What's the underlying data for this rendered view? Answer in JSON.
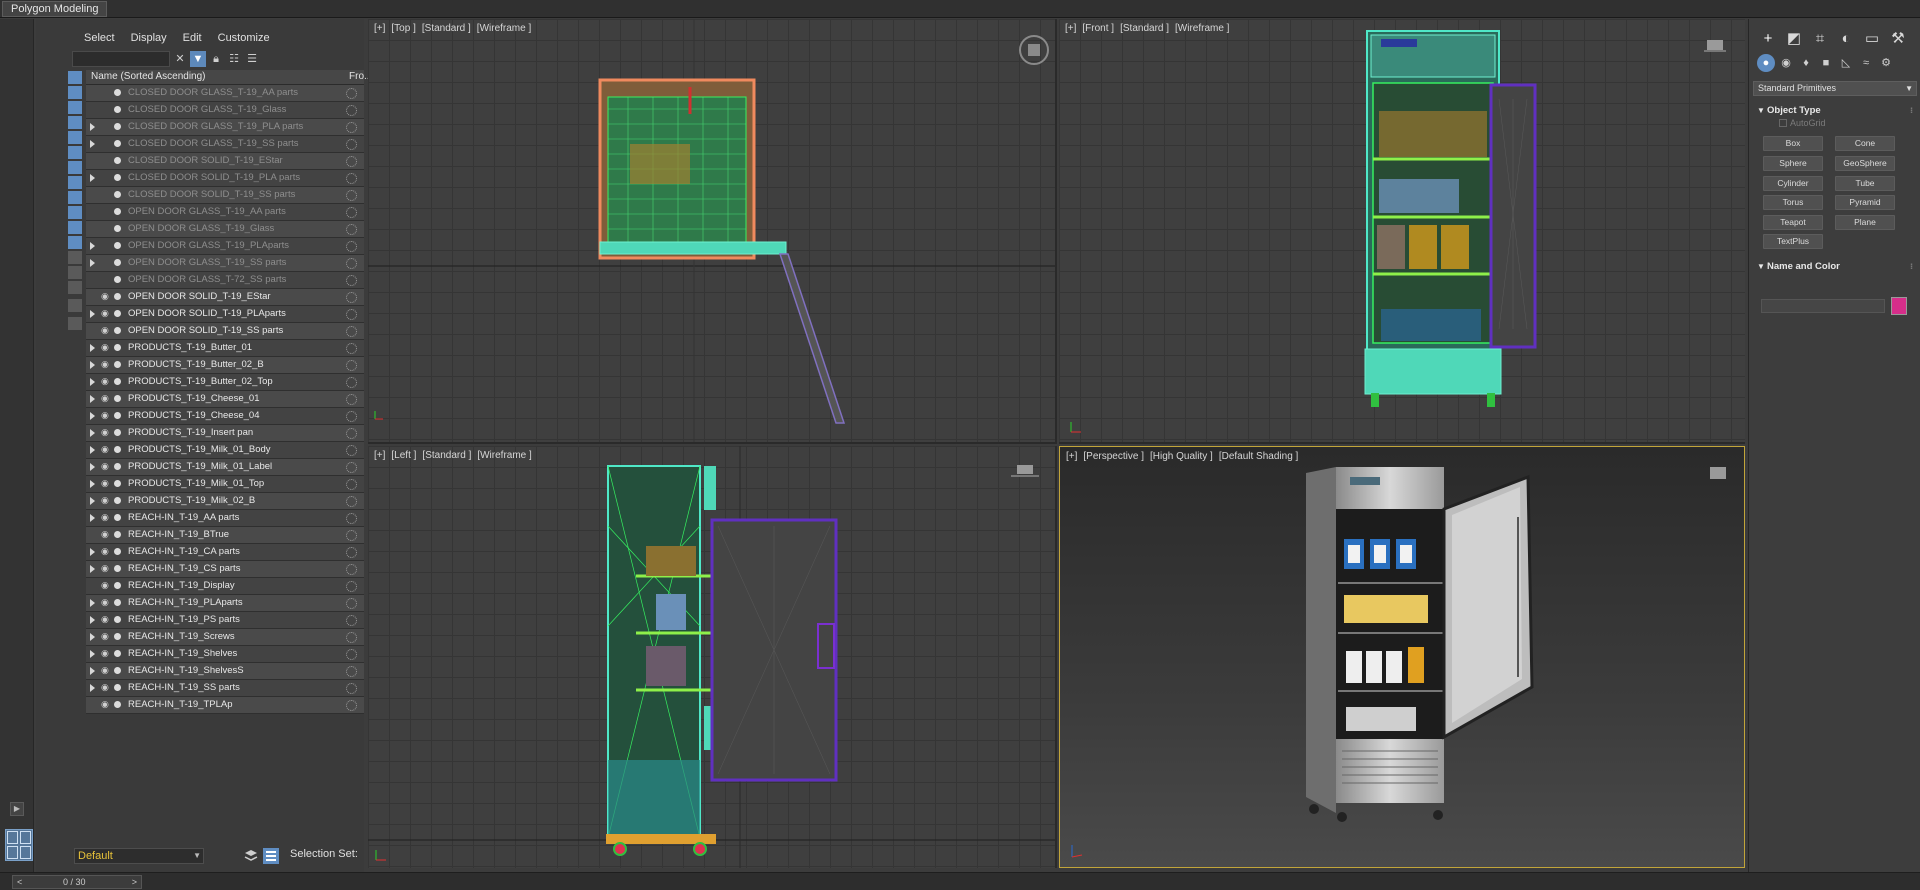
{
  "ribbon": {
    "tab_label": "Polygon Modeling"
  },
  "explorer": {
    "menu": [
      "Select",
      "Display",
      "Edit",
      "Customize"
    ],
    "columns": {
      "name": "Name (Sorted Ascending)",
      "frozen": "Fro..."
    },
    "rows": [
      {
        "label": "CLOSED DOOR GLASS_T-19_AA parts",
        "state": "hidden",
        "expandable": false
      },
      {
        "label": "CLOSED DOOR GLASS_T-19_Glass",
        "state": "hidden",
        "expandable": false
      },
      {
        "label": "CLOSED DOOR GLASS_T-19_PLA parts",
        "state": "hidden",
        "expandable": true
      },
      {
        "label": "CLOSED DOOR GLASS_T-19_SS parts",
        "state": "hidden",
        "expandable": true
      },
      {
        "label": "CLOSED DOOR SOLID_T-19_EStar",
        "state": "hidden",
        "expandable": false
      },
      {
        "label": "CLOSED DOOR SOLID_T-19_PLA parts",
        "state": "hidden",
        "expandable": true
      },
      {
        "label": "CLOSED DOOR SOLID_T-19_SS parts",
        "state": "hidden",
        "expandable": false
      },
      {
        "label": "OPEN DOOR GLASS_T-19_AA parts",
        "state": "hidden",
        "expandable": false
      },
      {
        "label": "OPEN DOOR GLASS_T-19_Glass",
        "state": "hidden",
        "expandable": false
      },
      {
        "label": "OPEN DOOR GLASS_T-19_PLAparts",
        "state": "hidden",
        "expandable": true
      },
      {
        "label": "OPEN DOOR GLASS_T-19_SS parts",
        "state": "hidden",
        "expandable": true
      },
      {
        "label": "OPEN DOOR GLASS_T-72_SS parts",
        "state": "hidden",
        "expandable": false
      },
      {
        "label": "OPEN DOOR SOLID_T-19_EStar",
        "state": "shown",
        "expandable": false
      },
      {
        "label": "OPEN DOOR SOLID_T-19_PLAparts",
        "state": "shown",
        "expandable": true
      },
      {
        "label": "OPEN DOOR SOLID_T-19_SS parts",
        "state": "shown",
        "expandable": false
      },
      {
        "label": "PRODUCTS_T-19_Butter_01",
        "state": "shown",
        "expandable": true
      },
      {
        "label": "PRODUCTS_T-19_Butter_02_B",
        "state": "shown",
        "expandable": true
      },
      {
        "label": "PRODUCTS_T-19_Butter_02_Top",
        "state": "shown",
        "expandable": true
      },
      {
        "label": "PRODUCTS_T-19_Cheese_01",
        "state": "shown",
        "expandable": true
      },
      {
        "label": "PRODUCTS_T-19_Cheese_04",
        "state": "shown",
        "expandable": true
      },
      {
        "label": "PRODUCTS_T-19_Insert pan",
        "state": "shown",
        "expandable": true
      },
      {
        "label": "PRODUCTS_T-19_Milk_01_Body",
        "state": "shown",
        "expandable": true
      },
      {
        "label": "PRODUCTS_T-19_Milk_01_Label",
        "state": "shown",
        "expandable": true
      },
      {
        "label": "PRODUCTS_T-19_Milk_01_Top",
        "state": "shown",
        "expandable": true
      },
      {
        "label": "PRODUCTS_T-19_Milk_02_B",
        "state": "shown",
        "expandable": true
      },
      {
        "label": "REACH-IN_T-19_AA parts",
        "state": "shown",
        "expandable": true
      },
      {
        "label": "REACH-IN_T-19_BTrue",
        "state": "shown",
        "expandable": false
      },
      {
        "label": "REACH-IN_T-19_CA parts",
        "state": "shown",
        "expandable": true
      },
      {
        "label": "REACH-IN_T-19_CS parts",
        "state": "shown",
        "expandable": true
      },
      {
        "label": "REACH-IN_T-19_Display",
        "state": "shown",
        "expandable": false
      },
      {
        "label": "REACH-IN_T-19_PLAparts",
        "state": "shown",
        "expandable": true
      },
      {
        "label": "REACH-IN_T-19_PS parts",
        "state": "shown",
        "expandable": true
      },
      {
        "label": "REACH-IN_T-19_Screws",
        "state": "shown",
        "expandable": true
      },
      {
        "label": "REACH-IN_T-19_Shelves",
        "state": "shown",
        "expandable": true
      },
      {
        "label": "REACH-IN_T-19_ShelvesS",
        "state": "shown",
        "expandable": true
      },
      {
        "label": "REACH-IN_T-19_SS parts",
        "state": "shown",
        "expandable": true
      },
      {
        "label": "REACH-IN_T-19_TPLAp",
        "state": "shown",
        "expandable": false
      }
    ],
    "layer_value": "Default",
    "selection_set_label": "Selection Set:"
  },
  "status": {
    "frame": "0 / 30",
    "prev": "<",
    "next": ">"
  },
  "viewports": {
    "top": [
      "[+]",
      "[Top ]",
      "[Standard ]",
      "[Wireframe ]"
    ],
    "front": [
      "[+]",
      "[Front ]",
      "[Standard ]",
      "[Wireframe ]"
    ],
    "left": [
      "[+]",
      "[Left ]",
      "[Standard ]",
      "[Wireframe ]"
    ],
    "perspective": [
      "[+]",
      "[Perspective ]",
      "[High Quality ]",
      "[Default Shading ]"
    ]
  },
  "command_panel": {
    "category": "Standard Primitives",
    "object_type_title": "Object Type",
    "autogrid_label": "AutoGrid",
    "primitives": [
      "Box",
      "Cone",
      "Sphere",
      "GeoSphere",
      "Cylinder",
      "Tube",
      "Torus",
      "Pyramid",
      "Teapot",
      "Plane",
      "TextPlus"
    ],
    "name_color_title": "Name and Color",
    "object_color": "#d62e8a"
  },
  "colors": {
    "accent_blue": "#5f8dc2",
    "active_viewport_border": "#c2a53a",
    "layer_text": "#e7c23a"
  }
}
